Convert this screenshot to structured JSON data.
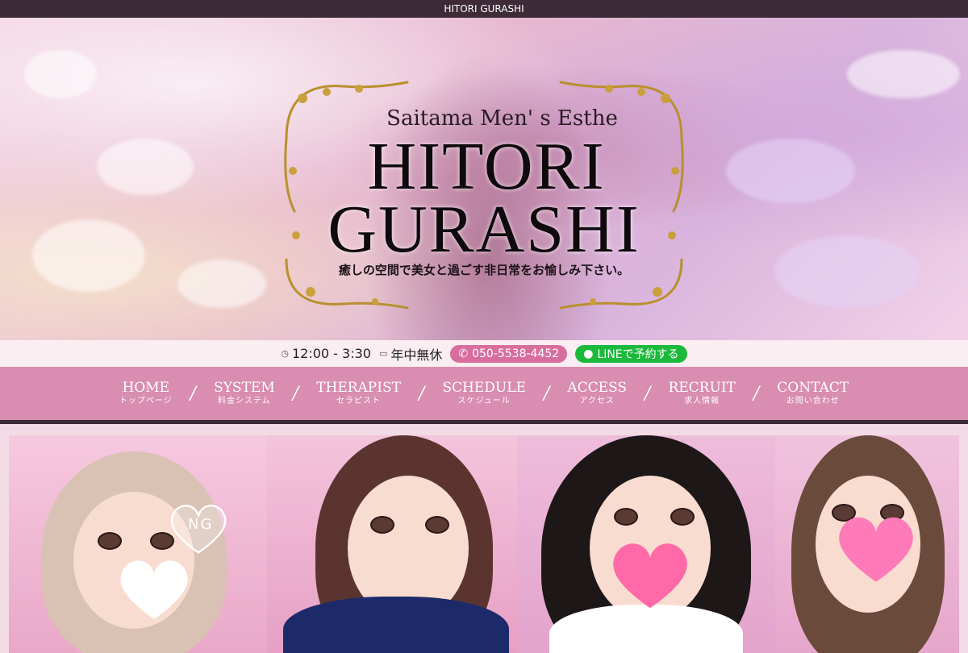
{
  "topbar": {
    "title": "HITORI GURASHI"
  },
  "hero": {
    "subtitle": "Saitama Men' s Esthe",
    "name_line1": "HITORI",
    "name_line2": "GURASHI",
    "tagline": "癒しの空間で美女と過ごす非日常をお愉しみ下さい。"
  },
  "info": {
    "hours": "12:00 - 3:30",
    "holiday": "年中無休",
    "phone": "050-5538-4452",
    "line_label": "LINEで予約する"
  },
  "nav": {
    "items": [
      {
        "en": "HOME",
        "jp": "トップページ"
      },
      {
        "en": "SYSTEM",
        "jp": "料金システム"
      },
      {
        "en": "THERAPIST",
        "jp": "セラピスト"
      },
      {
        "en": "SCHEDULE",
        "jp": "スケジュール"
      },
      {
        "en": "ACCESS",
        "jp": "アクセス"
      },
      {
        "en": "RECRUIT",
        "jp": "求人情報"
      },
      {
        "en": "CONTACT",
        "jp": "お問い合わせ"
      }
    ],
    "separator": "/"
  },
  "banner": {
    "ng_label": "NG"
  },
  "colors": {
    "topbar": "#3d2b38",
    "nav": "#d98db0",
    "tel_pill": "#d86e9e",
    "line_pill": "#1cba3c",
    "info_bg": "#fbeef2"
  },
  "icons": {
    "hours": "clock-icon",
    "holiday": "calendar-icon",
    "phone": "phone-icon",
    "line": "line-chat-icon"
  }
}
